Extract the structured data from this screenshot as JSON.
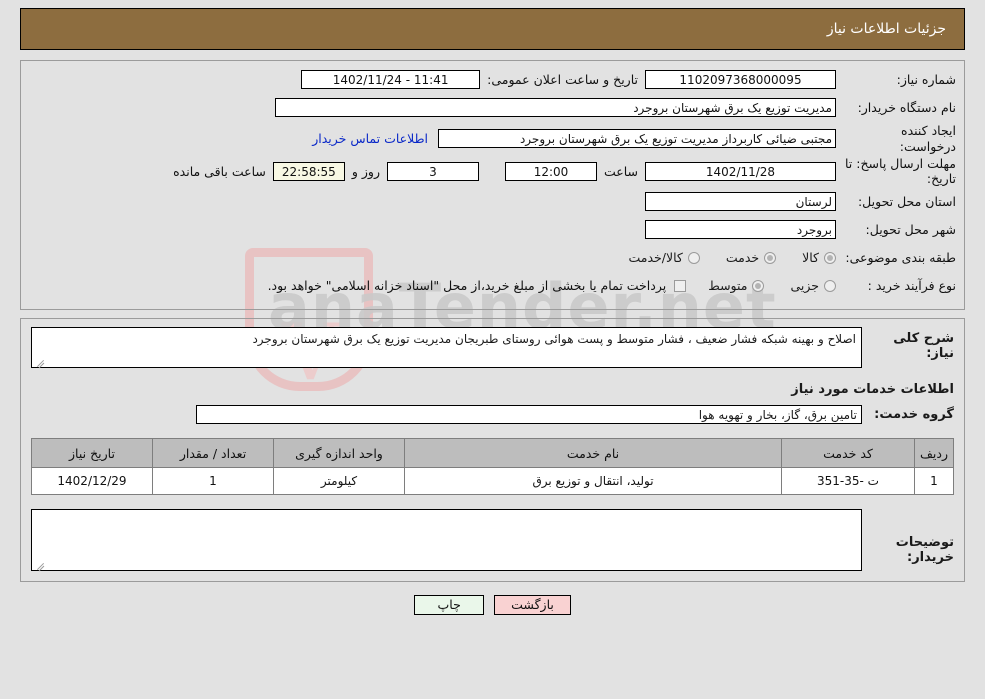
{
  "header": {
    "title": "جزئیات اطلاعات نیاز"
  },
  "form": {
    "need_number_label": "شماره نیاز:",
    "need_number_value": "1102097368000095",
    "announce_label": "تاریخ و ساعت اعلان عمومی:",
    "announce_value": "11:41 - 1402/11/24",
    "buyer_org_label": "نام دستگاه خریدار:",
    "buyer_org_value": "مدیریت توزیع یک برق شهرستان بروجرد",
    "creator_label": "ایجاد کننده درخواست:",
    "creator_value": "مجتبی ضیائی کاربرداز مدیریت توزیع یک برق شهرستان بروجرد",
    "contact_link": "اطلاعات تماس خریدار",
    "deadline_label": "مهلت ارسال پاسخ: تا تاریخ:",
    "deadline_value": "1402/11/28",
    "hour_label": "ساعت",
    "hour_value": "12:00",
    "days_value": "3",
    "days_label": "روز و",
    "timer_value": "22:58:55",
    "timer_suffix": "ساعت باقی مانده",
    "province_label": "استان محل تحویل:",
    "province_value": "لرستان",
    "city_label": "شهر محل تحویل:",
    "city_value": "بروجرد",
    "category_label": "طبقه بندی موضوعی:",
    "category_options": [
      {
        "label": "کالا",
        "checked": true
      },
      {
        "label": "خدمت",
        "checked": true
      },
      {
        "label": "کالا/خدمت",
        "checked": false
      }
    ],
    "process_label": "نوع فرآیند خرید :",
    "process_options": [
      {
        "label": "جزیی",
        "checked": false
      },
      {
        "label": "متوسط",
        "checked": true
      }
    ],
    "treasury_note": "پرداخت تمام یا بخشی از مبلغ خرید،از محل \"اسناد خزانه اسلامی\" خواهد بود."
  },
  "details": {
    "general_desc_label": "شرح کلی نیاز:",
    "general_desc_value": "اصلاح و بهینه شبکه فشار ضعیف ، فشار متوسط و پست هوائی روستای طبریجان مدیریت توزیع یک برق شهرستان بروجرد",
    "services_section_title": "اطلاعات خدمات مورد نیاز",
    "service_group_label": "گروه خدمت:",
    "service_group_value": "تامین برق، گاز، بخار و تهویه هوا",
    "buyer_notes_label": "توضیحات خریدار:",
    "buyer_notes_value": ""
  },
  "table": {
    "headers": [
      "ردیف",
      "کد خدمت",
      "نام خدمت",
      "واحد اندازه گیری",
      "تعداد / مقدار",
      "تاریخ نیاز"
    ],
    "rows": [
      {
        "radif": "1",
        "code": "ت -35-351",
        "name": "تولید، انتقال و توزیع برق",
        "unit": "کیلومتر",
        "qty": "1",
        "date": "1402/12/29"
      }
    ]
  },
  "footer": {
    "print_label": "چاپ",
    "back_label": "بازگشت"
  },
  "colors": {
    "header_bg": "#8d6d3f",
    "link": "#0a28c8",
    "timer_bg": "#f8f8e4",
    "table_header_bg": "#bdbdbd",
    "print_bg": "#eaf7ea",
    "back_bg": "#f9d2d2"
  }
}
